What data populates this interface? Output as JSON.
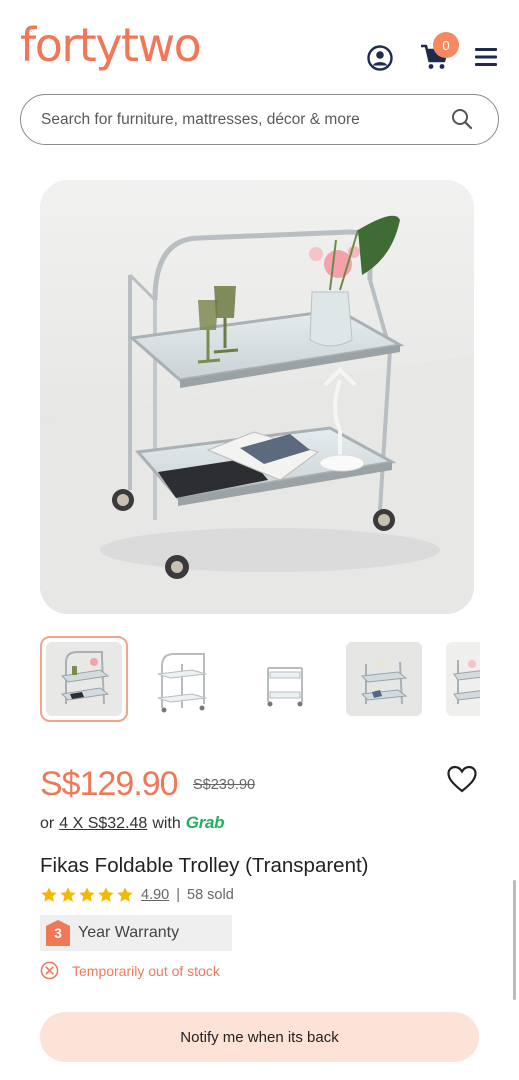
{
  "colors": {
    "brand": "#f07856",
    "badge": "#f58a62",
    "navy": "#1f2b4d",
    "star": "#f5b800",
    "grab": "#1fb35c",
    "oos": "#f0795b",
    "notify_bg": "#fde2d8",
    "warranty_tag": "#f07856"
  },
  "header": {
    "logo": "fortytwo",
    "account_icon": "user-circle-icon",
    "cart_icon": "shopping-cart-icon",
    "cart_count": "0",
    "menu_icon": "hamburger-menu-icon"
  },
  "search": {
    "placeholder": "Search for furniture, mattresses, décor & more",
    "icon": "search-icon"
  },
  "gallery": {
    "main_image": "foldable-trolley-photo",
    "thumbnails": [
      "thumb-1",
      "thumb-2",
      "thumb-3",
      "thumb-4",
      "thumb-5"
    ],
    "active_index": 0
  },
  "product": {
    "price": "S$129.90",
    "original_price": "S$239.90",
    "installment_prefix": "or",
    "installment_amount": "4 X S$32.48",
    "installment_with": "with",
    "installment_provider": "Grab",
    "title": "Fikas Foldable Trolley (Transparent)",
    "rating": "4.90",
    "rating_stars": 5,
    "separator": "|",
    "sold": "58 sold",
    "warranty_years": "3",
    "warranty_label": "Year Warranty",
    "stock_status": "Temporarily out of stock",
    "notify_label": "Notify me when its back"
  }
}
